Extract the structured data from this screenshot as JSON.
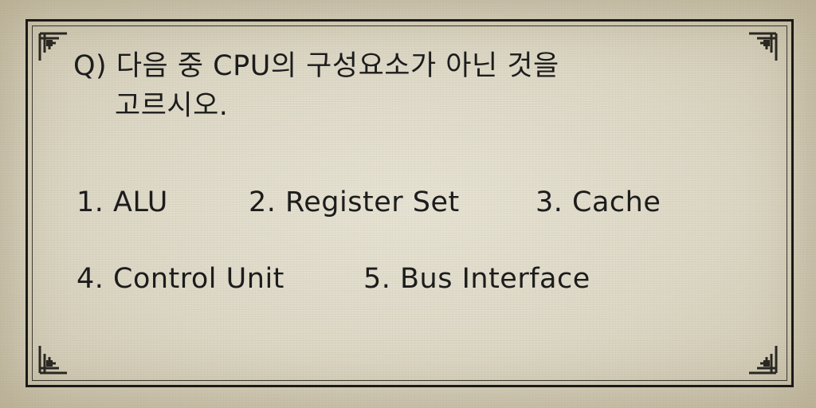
{
  "question": {
    "line1": "Q) 다음 중 CPU의 구성요소가 아닌 것을",
    "line2": "고르시오."
  },
  "options": [
    {
      "label": "1. ALU"
    },
    {
      "label": "2. Register Set"
    },
    {
      "label": "3. Cache"
    },
    {
      "label": "4. Control Unit"
    },
    {
      "label": "5. Bus Interface"
    }
  ],
  "colors": {
    "paper": "#e2ddcc",
    "ink": "#1c1c1c",
    "frame": "#1a1a17"
  },
  "icons": {
    "corner": "ornamental-corner-icon"
  }
}
